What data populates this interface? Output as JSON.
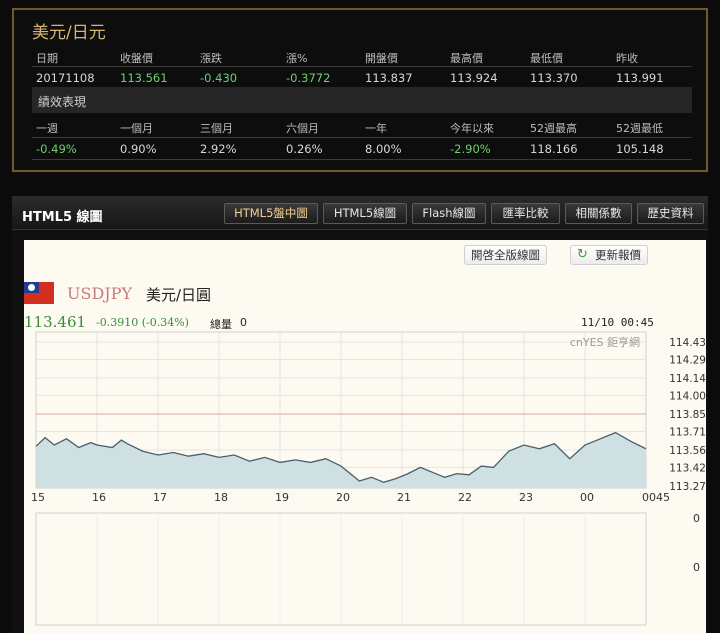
{
  "quote": {
    "title": "美元/日元",
    "headers": [
      "日期",
      "收盤價",
      "漲跌",
      "漲%",
      "開盤價",
      "最高價",
      "最低價",
      "昨收"
    ],
    "values": [
      "20171108",
      "113.561",
      "-0.430",
      "-0.3772",
      "113.837",
      "113.924",
      "113.370",
      "113.991"
    ],
    "perf_title": "績效表現",
    "perf_headers": [
      "一週",
      "一個月",
      "三個月",
      "六個月",
      "一年",
      "今年以來",
      "52週最高",
      "52週最低"
    ],
    "perf_values": [
      "-0.49%",
      "0.90%",
      "2.92%",
      "0.26%",
      "8.00%",
      "-2.90%",
      "118.166",
      "105.148"
    ]
  },
  "chart_panel": {
    "title": "HTML5 線圖",
    "tabs": [
      "HTML5盤中圖",
      "HTML5線圖",
      "Flash線圖",
      "匯率比較",
      "相關係數",
      "歷史資料"
    ],
    "active_tab": 0,
    "open_full_label": "開啓全版線圖",
    "refresh_label": "更新報價",
    "symbol": "USDJPY",
    "symbol_name": "美元/日圓",
    "price": "113.461",
    "change": "-0.3910 (-0.34%)",
    "volume_label": "總量",
    "volume_value": "0",
    "timestamp": "11/10 00:45",
    "watermark": "cnYES 鉅亨網"
  },
  "chart_data": {
    "type": "area",
    "title": "",
    "xlabel": "",
    "ylabel": "",
    "x_tick_labels": [
      "15",
      "16",
      "17",
      "18",
      "19",
      "20",
      "21",
      "22",
      "23",
      "00",
      "0045"
    ],
    "y_tick_labels": [
      "114.43",
      "114.29",
      "114.14",
      "114.00",
      "113.85",
      "113.71",
      "113.56",
      "113.42",
      "113.27"
    ],
    "ylim": [
      113.27,
      114.43
    ],
    "reference_line": 113.85,
    "grid": true,
    "colors": {
      "line": "#4a5e6e",
      "fill": "#cfe0e2",
      "reference": "#e7a4a4"
    },
    "series": [
      {
        "x": [
          0,
          0.3,
          0.6,
          1.0,
          1.4,
          1.8,
          2.0,
          2.5,
          2.8,
          3.0,
          3.5,
          4.0,
          4.5,
          5.0,
          5.5,
          6.0,
          6.5,
          7.0,
          7.5,
          8.0,
          8.5,
          9.0,
          9.5,
          10.0,
          10.6,
          11.0,
          11.4,
          11.8,
          12.2,
          12.6,
          13.0,
          13.4,
          13.8,
          14.2,
          14.6,
          15.0,
          15.5,
          16.0,
          16.5,
          17.0,
          17.5,
          18.0,
          18.5,
          19.0,
          19.5,
          20.0
        ],
        "y": [
          113.59,
          113.66,
          113.6,
          113.65,
          113.58,
          113.62,
          113.6,
          113.58,
          113.64,
          113.61,
          113.55,
          113.52,
          113.54,
          113.51,
          113.53,
          113.5,
          113.52,
          113.47,
          113.5,
          113.46,
          113.48,
          113.46,
          113.49,
          113.43,
          113.31,
          113.34,
          113.3,
          113.33,
          113.37,
          113.42,
          113.38,
          113.34,
          113.37,
          113.36,
          113.43,
          113.42,
          113.55,
          113.6,
          113.57,
          113.61,
          113.49,
          113.6,
          113.65,
          113.7,
          113.63,
          113.57
        ]
      }
    ]
  }
}
